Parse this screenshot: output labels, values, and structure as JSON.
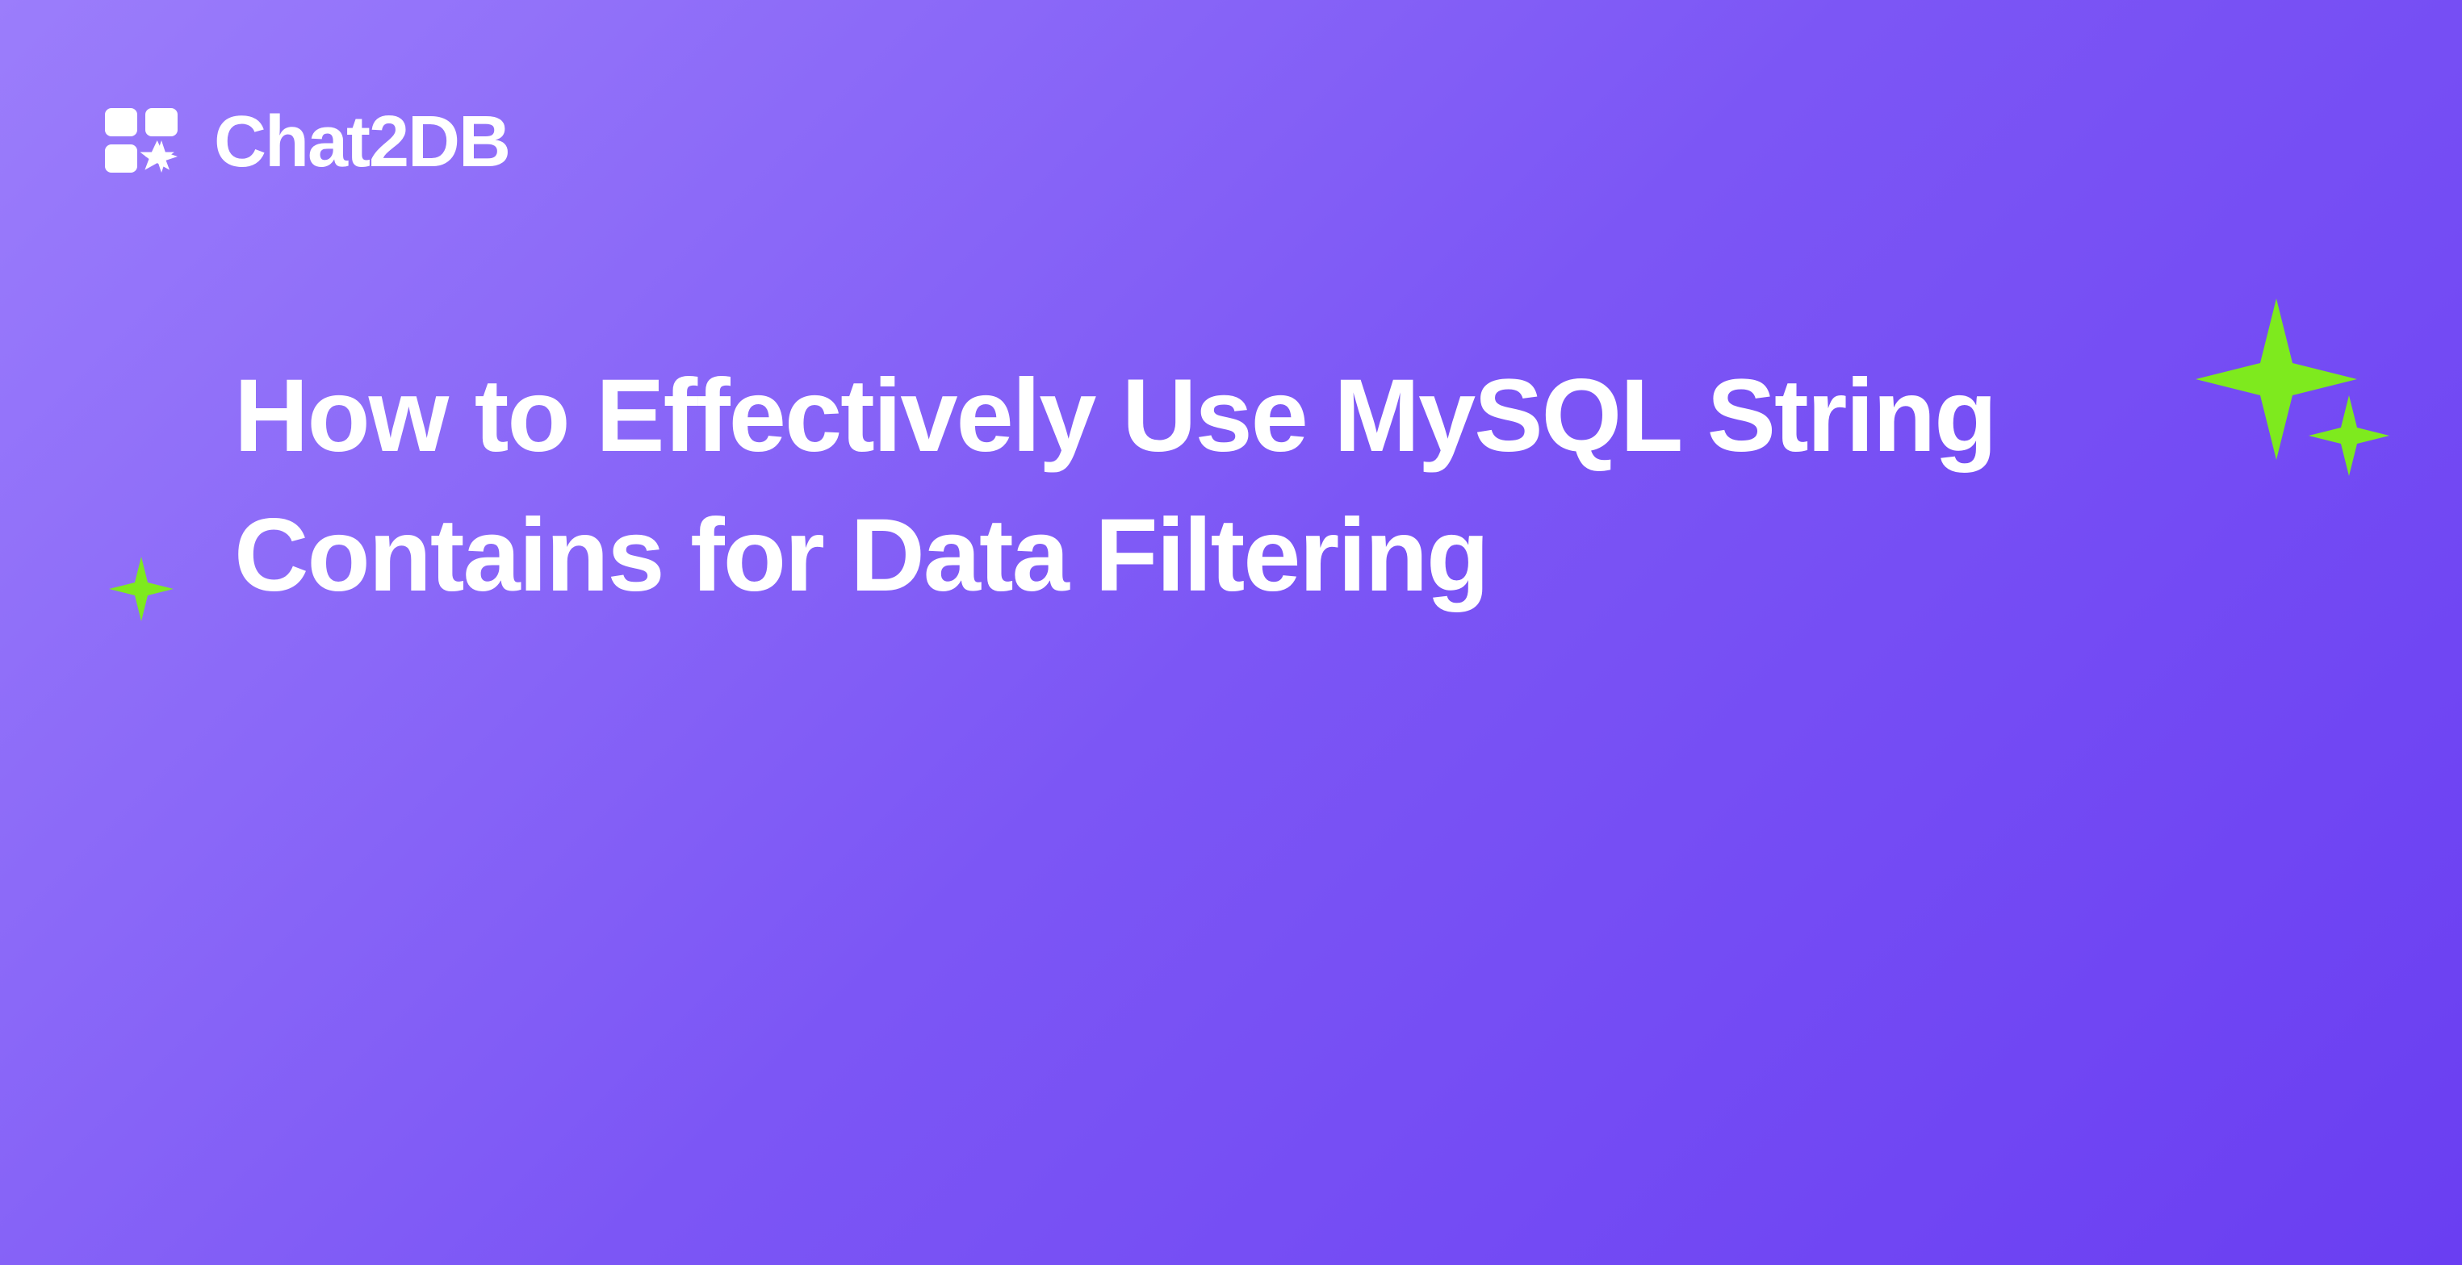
{
  "logo": {
    "text": "Chat2DB"
  },
  "title": "How to Effectively Use MySQL String Contains for Data Filtering",
  "accent_color": "#7eea1e"
}
